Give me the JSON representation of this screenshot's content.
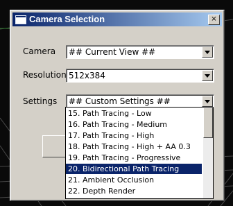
{
  "window": {
    "title": "Camera Selection",
    "close_label": "×"
  },
  "fields": [
    {
      "label": "Camera",
      "value": "## Current View ##"
    },
    {
      "label": "Resolution",
      "value": "512x384"
    },
    {
      "label": "Settings",
      "value": "## Custom Settings ##"
    }
  ],
  "dropdown": {
    "items": [
      "15. Path Tracing - Low",
      "16. Path Tracing - Medium",
      "17. Path Tracing - High",
      "18. Path Tracing - High + AA 0.3",
      "19. Path Tracing - Progressive",
      "20. Bidirectional Path Tracing",
      "21. Ambient Occlusion",
      "22. Depth Render"
    ],
    "selected_index": 5
  },
  "colors": {
    "titlebar": "#0a246a",
    "selection": "#0a246a",
    "dialog_bg": "#d4d0c8",
    "grid": "#5a5a5a"
  }
}
